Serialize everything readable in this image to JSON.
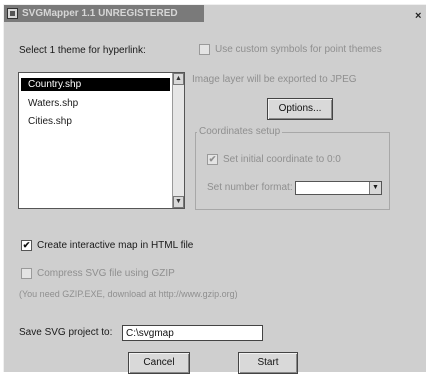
{
  "window": {
    "title": "SVGMapper 1.1 UNREGISTERED",
    "close_glyph": "×"
  },
  "theme_picker": {
    "label": "Select 1 theme for hyperlink:",
    "items": [
      "Country.shp",
      "Waters.shp",
      "Cities.shp"
    ],
    "selected_index": 0
  },
  "custom_symbols": {
    "label": "Use custom symbols for point themes",
    "checked": false,
    "enabled": false
  },
  "image_export": {
    "note": "Image layer will be exported to JPEG",
    "options_label": "Options..."
  },
  "coordinates": {
    "group_title": "Coordinates setup",
    "set_initial_label": "Set initial coordinate to 0:0",
    "set_initial_checked": true,
    "number_format_label": "Set number format:",
    "number_format_value": ""
  },
  "html_map": {
    "label": "Create interactive map in HTML file",
    "checked": true
  },
  "compress": {
    "label": "Compress SVG file using GZIP",
    "checked": false,
    "enabled": false,
    "note": "(You need GZIP.EXE, download at http://www.gzip.org)"
  },
  "project": {
    "save_label": "Save SVG project to:",
    "path": "C:\\svgmap"
  },
  "actions": {
    "cancel_label": "Cancel",
    "start_label": "Start"
  },
  "glyphs": {
    "check": "✔",
    "up": "▲",
    "down": "▼"
  }
}
